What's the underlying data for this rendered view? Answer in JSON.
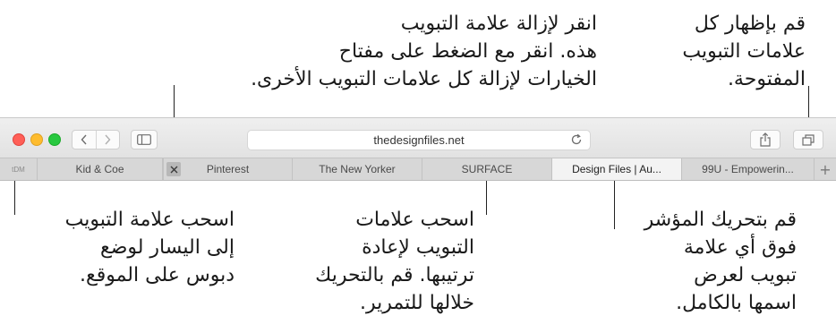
{
  "callouts": {
    "show_all_tabs": [
      "قم بإظهار كل",
      "علامات التبويب",
      "المفتوحة."
    ],
    "close_tab": [
      "انقر لإزالة علامة التبويب",
      "هذه. انقر مع الضغط على مفتاح",
      "الخيارات لإزالة كل علامات التبويب الأخرى."
    ],
    "pin_tab": [
      "اسحب علامة التبويب",
      "إلى اليسار لوضع",
      "دبوس على الموقع."
    ],
    "reorder_tabs": [
      "اسحب علامات",
      "التبويب لإعادة",
      "ترتيبها. قم بالتحريك",
      "خلالها للتمرير."
    ],
    "hover_tab": [
      "قم بتحريك المؤشر",
      "فوق أي علامة",
      "تبويب لعرض",
      "اسمها بالكامل."
    ]
  },
  "browser": {
    "address": "thedesignfiles.net",
    "pinned_label": "tDM",
    "tabs": [
      "Kid & Coe",
      "Pinterest",
      "The New Yorker",
      "SURFACE",
      "Design Files | Au...",
      "99U - Empowerin..."
    ],
    "active_tab_index": 4,
    "new_tab_label": "+"
  },
  "colors": {
    "traffic_red": "#ff5f57",
    "traffic_yellow": "#febc2e",
    "traffic_green": "#28c840"
  },
  "icons": [
    "back-icon",
    "forward-icon",
    "sidebar-icon",
    "reload-icon",
    "share-icon",
    "tabs-overview-icon",
    "close-icon",
    "plus-icon"
  ]
}
